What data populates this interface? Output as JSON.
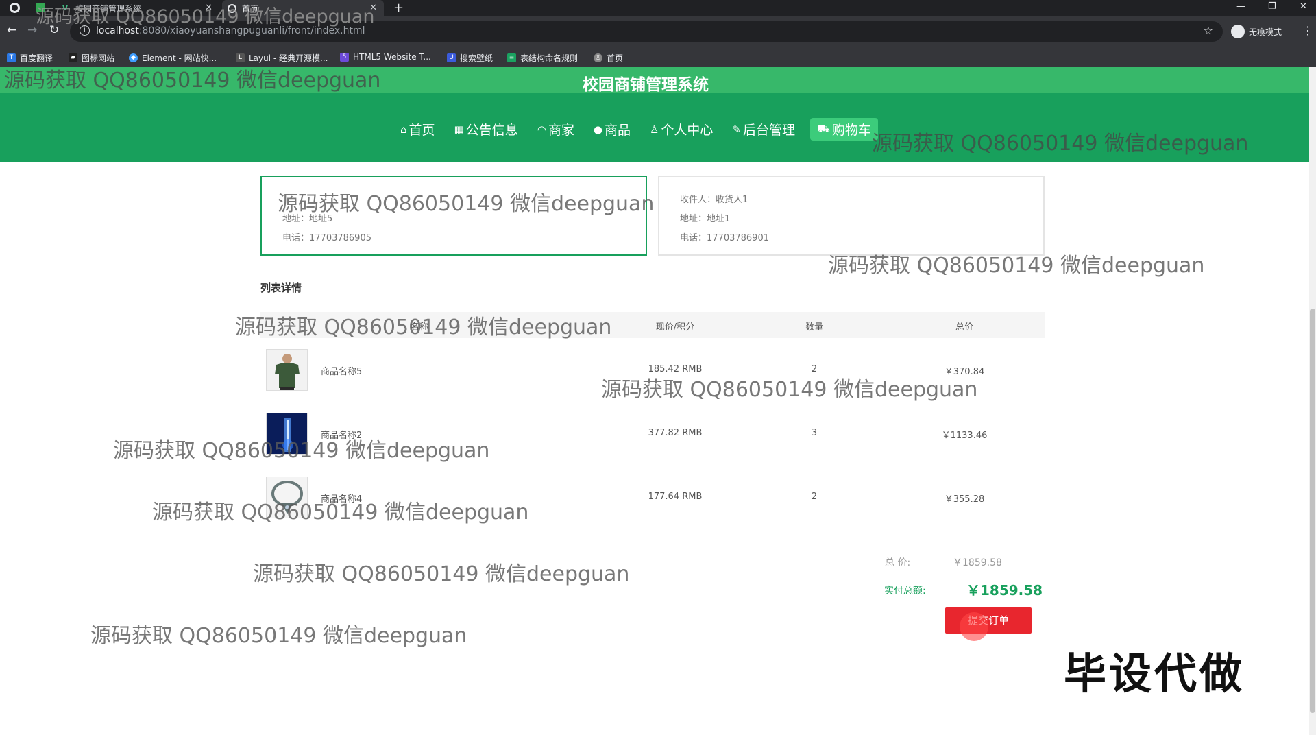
{
  "browser": {
    "tabs": [
      {
        "title": "校园商铺管理系统"
      },
      {
        "title": "首页"
      }
    ],
    "url_host": "localhost",
    "url_path": ":8080/xiaoyuanshangpuguanli/front/index.html",
    "incognito_label": "无痕模式",
    "bookmarks": [
      {
        "label": "百度翻译",
        "color": "#2b78e4"
      },
      {
        "label": "图标网站",
        "color": "#333333"
      },
      {
        "label": "Element - 网站快...",
        "color": "#409eff"
      },
      {
        "label": "Layui - 经典开源模...",
        "color": "#555555"
      },
      {
        "label": "HTML5 Website T...",
        "color": "#6c4ad8"
      },
      {
        "label": "搜索壁纸",
        "color": "#3b5bdb"
      },
      {
        "label": "表结构命名规则",
        "color": "#1aa260"
      },
      {
        "label": "首页",
        "color": "#888888"
      }
    ]
  },
  "site": {
    "title": "校园商铺管理系统",
    "nav": [
      {
        "icon": "home-icon",
        "glyph": "⌂",
        "label": "首页"
      },
      {
        "icon": "notice-icon",
        "glyph": "▦",
        "label": "公告信息"
      },
      {
        "icon": "merchant-icon",
        "glyph": "◠",
        "label": "商家"
      },
      {
        "icon": "goods-icon",
        "glyph": "●",
        "label": "商品"
      },
      {
        "icon": "user-icon",
        "glyph": "♙",
        "label": "个人中心"
      },
      {
        "icon": "link-icon",
        "glyph": "✎",
        "label": "后台管理"
      },
      {
        "icon": "cart-icon",
        "glyph": "⛟",
        "label": "购物车"
      }
    ]
  },
  "addresses": [
    {
      "address": "地址：地址5",
      "phone": "电话：17703786905",
      "selected": true
    },
    {
      "receiver": "收件人：收货人1",
      "address": "地址：地址1",
      "phone": "电话：17703786901",
      "selected": false
    }
  ],
  "list": {
    "title": "列表详情",
    "headers": [
      "名称",
      "现价/积分",
      "数量",
      "总价"
    ],
    "rows": [
      {
        "name": "商品名称5",
        "price": "185.42 RMB",
        "qty": "2",
        "total": "￥370.84"
      },
      {
        "name": "商品名称2",
        "price": "377.82 RMB",
        "qty": "3",
        "total": "￥1133.46"
      },
      {
        "name": "商品名称4",
        "price": "177.64 RMB",
        "qty": "2",
        "total": "￥355.28"
      }
    ]
  },
  "summary": {
    "total_label": "总 价:",
    "total_value": "￥1859.58",
    "pay_label": "实付总额:",
    "pay_value": "￥1859.58",
    "submit_label": "提交订单"
  },
  "watermark_text": "源码获取 QQ86050149 微信deepguan",
  "stamp_text": "毕设代做"
}
